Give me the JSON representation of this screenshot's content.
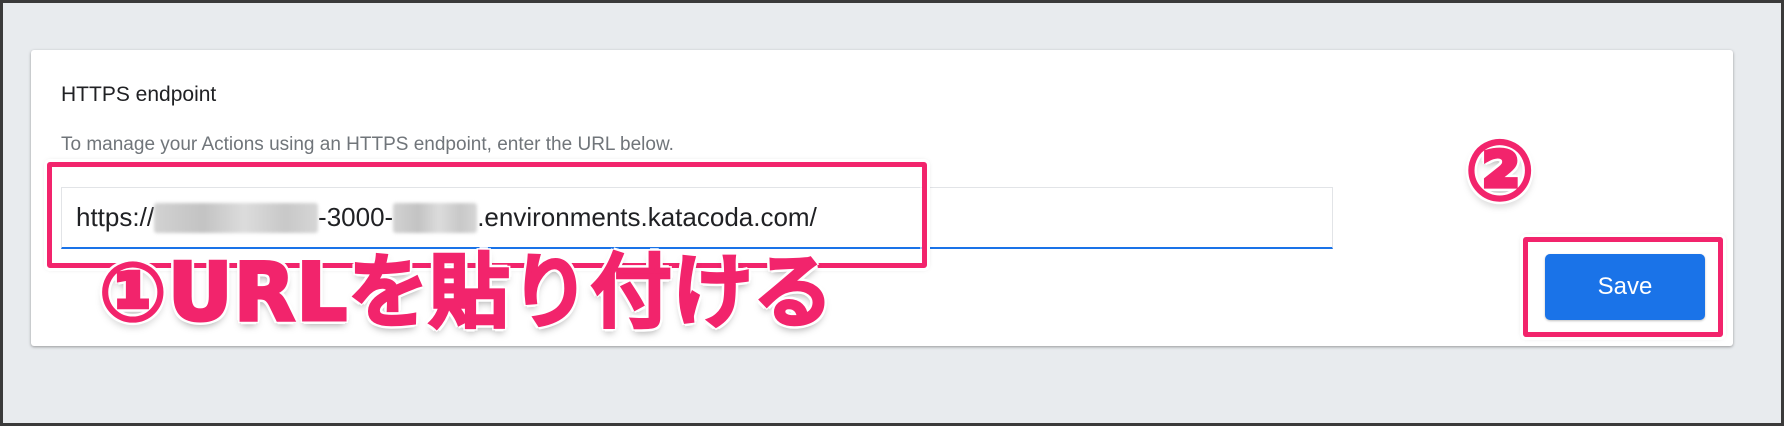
{
  "panel": {
    "title": "HTTPS endpoint",
    "description": "To manage your Actions using an HTTPS endpoint, enter the URL below."
  },
  "url_field": {
    "prefix": "https://",
    "redacted_1": "",
    "middle": "-3000-",
    "redacted_2": "",
    "suffix": ".environments.katacoda.com/"
  },
  "buttons": {
    "save_label": "Save"
  },
  "annotations": {
    "step1": "①URLを貼り付ける",
    "step2": "②"
  },
  "colors": {
    "accent": "#1a73e8",
    "annotation": "#f2246c",
    "background": "#e8ebee"
  }
}
